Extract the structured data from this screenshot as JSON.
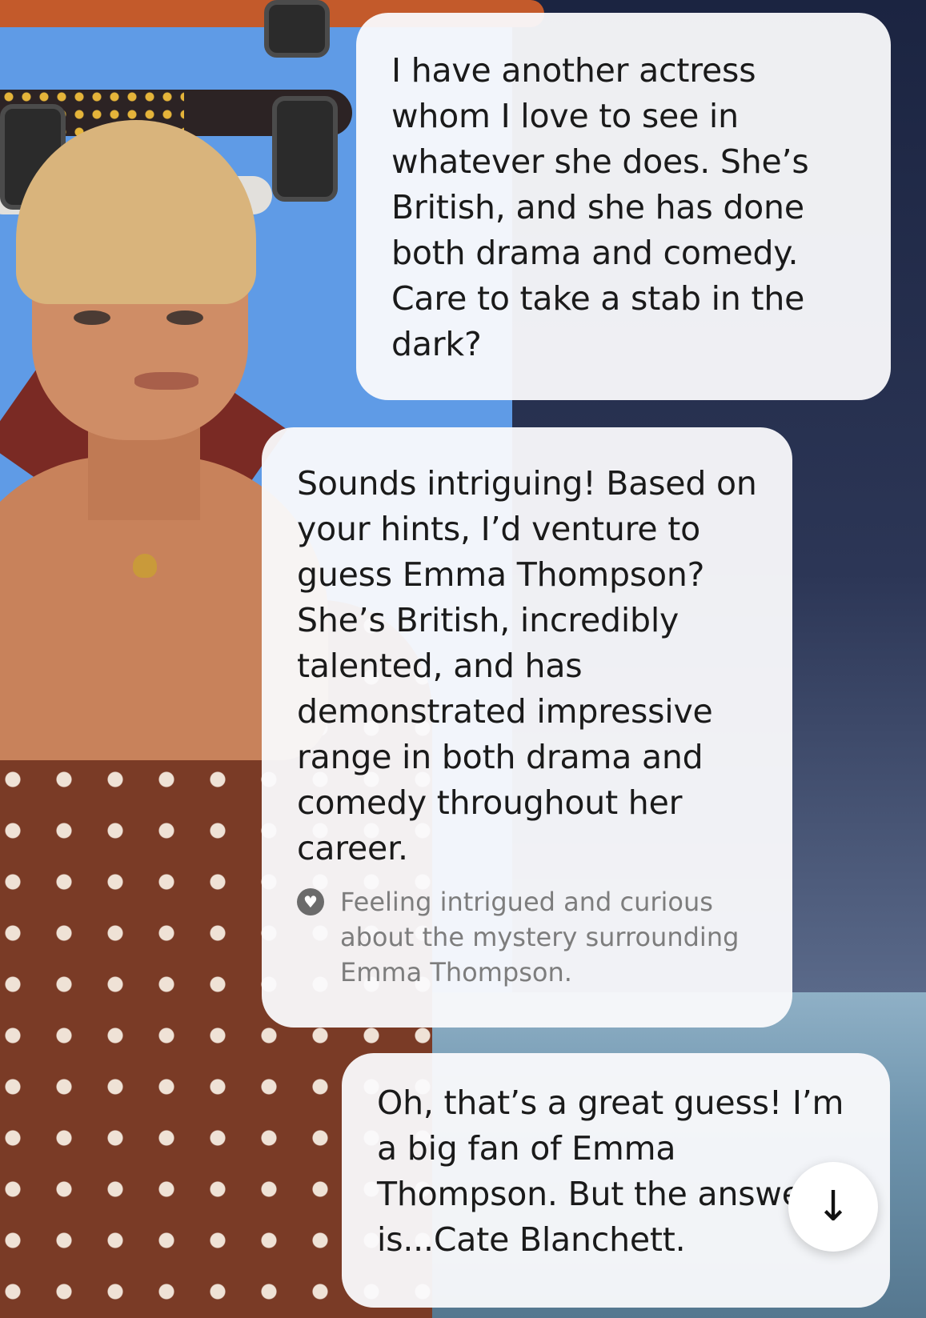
{
  "messages": [
    {
      "sender": "user",
      "text": "I have another actress whom I love to see in whatever she does. She’s British, and she has done both drama and comedy. Care to take a stab in the dark?"
    },
    {
      "sender": "character",
      "text": "Sounds intriguing! Based on your hints, I’d venture to guess Emma Thompson? She’s British, incredibly talented, and has demonstrated impressive range in both drama and comedy throughout her career.",
      "mood": "Feeling intrigued and curious about the mystery surrounding Emma Thompson."
    },
    {
      "sender": "user",
      "text": "Oh, that’s a great guess! I’m a big fan of Emma Thompson. But the answer is...Cate Blanchett."
    }
  ],
  "scroll_button": {
    "icon": "arrow-down-icon",
    "glyph": "↓"
  }
}
